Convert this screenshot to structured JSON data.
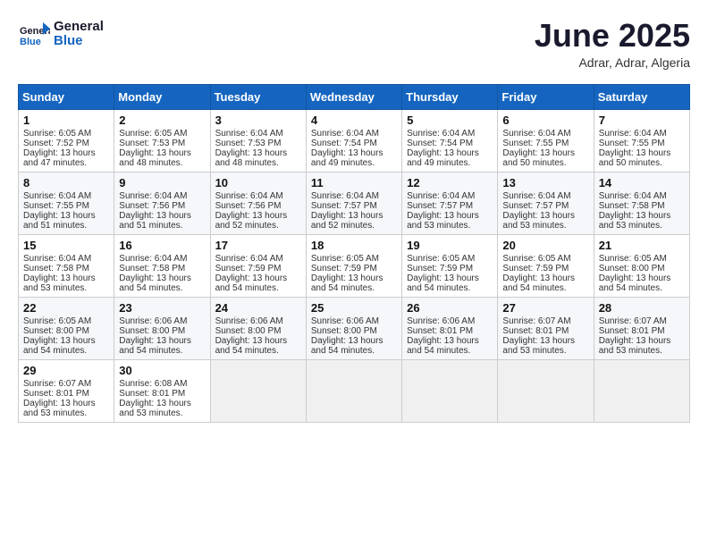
{
  "header": {
    "logo_general": "General",
    "logo_blue": "Blue",
    "month_title": "June 2025",
    "location": "Adrar, Adrar, Algeria"
  },
  "weekdays": [
    "Sunday",
    "Monday",
    "Tuesday",
    "Wednesday",
    "Thursday",
    "Friday",
    "Saturday"
  ],
  "weeks": [
    [
      {
        "day": "1",
        "lines": [
          "Sunrise: 6:05 AM",
          "Sunset: 7:52 PM",
          "Daylight: 13 hours",
          "and 47 minutes."
        ]
      },
      {
        "day": "2",
        "lines": [
          "Sunrise: 6:05 AM",
          "Sunset: 7:53 PM",
          "Daylight: 13 hours",
          "and 48 minutes."
        ]
      },
      {
        "day": "3",
        "lines": [
          "Sunrise: 6:04 AM",
          "Sunset: 7:53 PM",
          "Daylight: 13 hours",
          "and 48 minutes."
        ]
      },
      {
        "day": "4",
        "lines": [
          "Sunrise: 6:04 AM",
          "Sunset: 7:54 PM",
          "Daylight: 13 hours",
          "and 49 minutes."
        ]
      },
      {
        "day": "5",
        "lines": [
          "Sunrise: 6:04 AM",
          "Sunset: 7:54 PM",
          "Daylight: 13 hours",
          "and 49 minutes."
        ]
      },
      {
        "day": "6",
        "lines": [
          "Sunrise: 6:04 AM",
          "Sunset: 7:55 PM",
          "Daylight: 13 hours",
          "and 50 minutes."
        ]
      },
      {
        "day": "7",
        "lines": [
          "Sunrise: 6:04 AM",
          "Sunset: 7:55 PM",
          "Daylight: 13 hours",
          "and 50 minutes."
        ]
      }
    ],
    [
      {
        "day": "8",
        "lines": [
          "Sunrise: 6:04 AM",
          "Sunset: 7:55 PM",
          "Daylight: 13 hours",
          "and 51 minutes."
        ]
      },
      {
        "day": "9",
        "lines": [
          "Sunrise: 6:04 AM",
          "Sunset: 7:56 PM",
          "Daylight: 13 hours",
          "and 51 minutes."
        ]
      },
      {
        "day": "10",
        "lines": [
          "Sunrise: 6:04 AM",
          "Sunset: 7:56 PM",
          "Daylight: 13 hours",
          "and 52 minutes."
        ]
      },
      {
        "day": "11",
        "lines": [
          "Sunrise: 6:04 AM",
          "Sunset: 7:57 PM",
          "Daylight: 13 hours",
          "and 52 minutes."
        ]
      },
      {
        "day": "12",
        "lines": [
          "Sunrise: 6:04 AM",
          "Sunset: 7:57 PM",
          "Daylight: 13 hours",
          "and 53 minutes."
        ]
      },
      {
        "day": "13",
        "lines": [
          "Sunrise: 6:04 AM",
          "Sunset: 7:57 PM",
          "Daylight: 13 hours",
          "and 53 minutes."
        ]
      },
      {
        "day": "14",
        "lines": [
          "Sunrise: 6:04 AM",
          "Sunset: 7:58 PM",
          "Daylight: 13 hours",
          "and 53 minutes."
        ]
      }
    ],
    [
      {
        "day": "15",
        "lines": [
          "Sunrise: 6:04 AM",
          "Sunset: 7:58 PM",
          "Daylight: 13 hours",
          "and 53 minutes."
        ]
      },
      {
        "day": "16",
        "lines": [
          "Sunrise: 6:04 AM",
          "Sunset: 7:58 PM",
          "Daylight: 13 hours",
          "and 54 minutes."
        ]
      },
      {
        "day": "17",
        "lines": [
          "Sunrise: 6:04 AM",
          "Sunset: 7:59 PM",
          "Daylight: 13 hours",
          "and 54 minutes."
        ]
      },
      {
        "day": "18",
        "lines": [
          "Sunrise: 6:05 AM",
          "Sunset: 7:59 PM",
          "Daylight: 13 hours",
          "and 54 minutes."
        ]
      },
      {
        "day": "19",
        "lines": [
          "Sunrise: 6:05 AM",
          "Sunset: 7:59 PM",
          "Daylight: 13 hours",
          "and 54 minutes."
        ]
      },
      {
        "day": "20",
        "lines": [
          "Sunrise: 6:05 AM",
          "Sunset: 7:59 PM",
          "Daylight: 13 hours",
          "and 54 minutes."
        ]
      },
      {
        "day": "21",
        "lines": [
          "Sunrise: 6:05 AM",
          "Sunset: 8:00 PM",
          "Daylight: 13 hours",
          "and 54 minutes."
        ]
      }
    ],
    [
      {
        "day": "22",
        "lines": [
          "Sunrise: 6:05 AM",
          "Sunset: 8:00 PM",
          "Daylight: 13 hours",
          "and 54 minutes."
        ]
      },
      {
        "day": "23",
        "lines": [
          "Sunrise: 6:06 AM",
          "Sunset: 8:00 PM",
          "Daylight: 13 hours",
          "and 54 minutes."
        ]
      },
      {
        "day": "24",
        "lines": [
          "Sunrise: 6:06 AM",
          "Sunset: 8:00 PM",
          "Daylight: 13 hours",
          "and 54 minutes."
        ]
      },
      {
        "day": "25",
        "lines": [
          "Sunrise: 6:06 AM",
          "Sunset: 8:00 PM",
          "Daylight: 13 hours",
          "and 54 minutes."
        ]
      },
      {
        "day": "26",
        "lines": [
          "Sunrise: 6:06 AM",
          "Sunset: 8:01 PM",
          "Daylight: 13 hours",
          "and 54 minutes."
        ]
      },
      {
        "day": "27",
        "lines": [
          "Sunrise: 6:07 AM",
          "Sunset: 8:01 PM",
          "Daylight: 13 hours",
          "and 53 minutes."
        ]
      },
      {
        "day": "28",
        "lines": [
          "Sunrise: 6:07 AM",
          "Sunset: 8:01 PM",
          "Daylight: 13 hours",
          "and 53 minutes."
        ]
      }
    ],
    [
      {
        "day": "29",
        "lines": [
          "Sunrise: 6:07 AM",
          "Sunset: 8:01 PM",
          "Daylight: 13 hours",
          "and 53 minutes."
        ]
      },
      {
        "day": "30",
        "lines": [
          "Sunrise: 6:08 AM",
          "Sunset: 8:01 PM",
          "Daylight: 13 hours",
          "and 53 minutes."
        ]
      },
      {
        "day": "",
        "lines": []
      },
      {
        "day": "",
        "lines": []
      },
      {
        "day": "",
        "lines": []
      },
      {
        "day": "",
        "lines": []
      },
      {
        "day": "",
        "lines": []
      }
    ]
  ]
}
